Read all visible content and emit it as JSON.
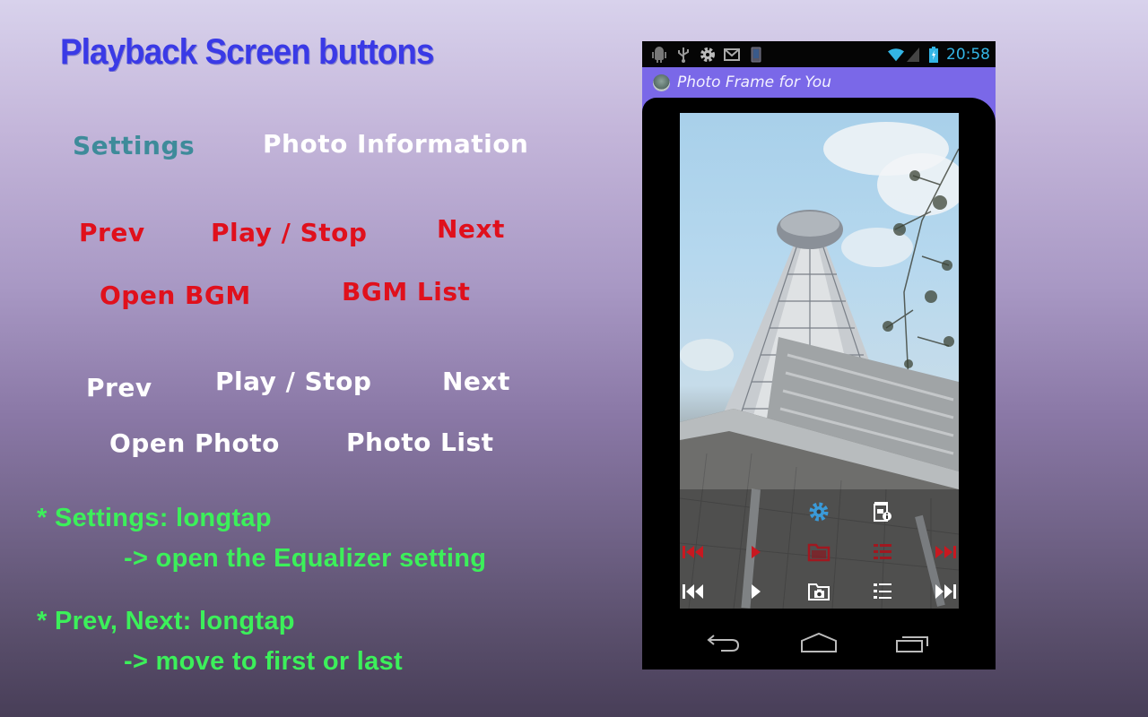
{
  "title": "Playback Screen buttons",
  "labels": {
    "settings": "Settings",
    "photo_information": "Photo Information",
    "bgm_prev": "Prev",
    "bgm_play_stop": "Play / Stop",
    "bgm_next": "Next",
    "open_bgm": "Open BGM",
    "bgm_list": "BGM List",
    "photo_prev": "Prev",
    "photo_play_stop": "Play / Stop",
    "photo_next": "Next",
    "open_photo": "Open Photo",
    "photo_list": "Photo List"
  },
  "notes": [
    {
      "line1": "* Settings: longtap",
      "line2": "-> open the Equalizer setting"
    },
    {
      "line1": "* Prev, Next: longtap",
      "line2": "-> move to first or last"
    }
  ],
  "colors": {
    "title": "#3a3ae6",
    "settings_label": "#3e8b9a",
    "bgm_labels": "#e0101c",
    "photo_labels": "#ffffff",
    "notes": "#3cf05a",
    "action_bar": "#7a68e8",
    "status_time": "#33b5e5"
  },
  "phone": {
    "status_bar": {
      "left_icons": [
        "android-debug-icon",
        "usb-icon",
        "settings-gear-icon",
        "gmail-icon",
        "phone-screen-icon"
      ],
      "right_icons": [
        "wifi-icon",
        "signal-icon",
        "battery-charging-icon"
      ],
      "time": "20:58"
    },
    "action_bar": {
      "app_title": "Photo Frame for You"
    },
    "controls": {
      "top_row": [
        "settings-gear-icon",
        "photo-info-icon"
      ],
      "bgm_row": [
        "bgm-prev-icon",
        "bgm-play-icon",
        "open-bgm-folder-icon",
        "bgm-list-icon",
        "bgm-next-icon"
      ],
      "photo_row": [
        "photo-prev-icon",
        "photo-play-icon",
        "open-photo-folder-icon",
        "photo-list-icon",
        "photo-next-icon"
      ]
    },
    "nav_bar": [
      "back-icon",
      "home-icon",
      "recent-apps-icon"
    ]
  }
}
